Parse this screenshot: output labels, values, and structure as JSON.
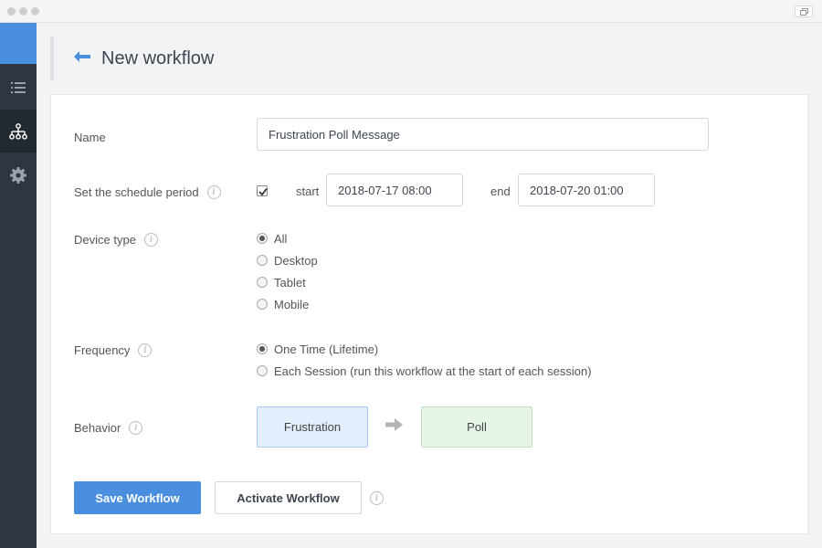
{
  "header": {
    "title": "New workflow"
  },
  "form": {
    "name": {
      "label": "Name",
      "value": "Frustration Poll Message"
    },
    "schedule": {
      "label": "Set the schedule period",
      "checked": true,
      "start_label": "start",
      "start_value": "2018-07-17 08:00",
      "end_label": "end",
      "end_value": "2018-07-20 01:00"
    },
    "device_type": {
      "label": "Device type",
      "options": [
        "All",
        "Desktop",
        "Tablet",
        "Mobile"
      ],
      "selected": "All"
    },
    "frequency": {
      "label": "Frequency",
      "options": [
        "One Time (Lifetime)",
        "Each Session (run this workflow at the start of each session)"
      ],
      "selected": "One Time (Lifetime)"
    },
    "behavior": {
      "label": "Behavior",
      "trigger": "Frustration",
      "action": "Poll"
    }
  },
  "buttons": {
    "save": "Save Workflow",
    "activate": "Activate Workflow"
  },
  "colors": {
    "accent": "#4a8ee0",
    "sidebar": "#2f363f",
    "sidebar_active": "#232930"
  },
  "icons": {
    "sidebar": [
      "list-icon",
      "hierarchy-icon",
      "gear-icon"
    ],
    "header": "back-arrow-icon",
    "info": "info-icon"
  }
}
